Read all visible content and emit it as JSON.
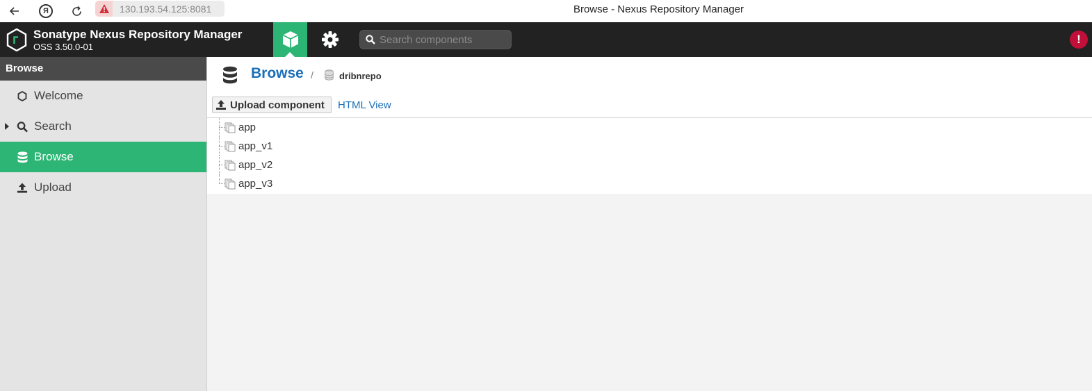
{
  "browser": {
    "url": "130.193.54.125:8081",
    "title": "Browse - Nexus Repository Manager",
    "ya_label": "Я"
  },
  "header": {
    "product_name": "Sonatype Nexus Repository Manager",
    "version": "OSS 3.50.0-01",
    "search_placeholder": "Search components",
    "alert_symbol": "!"
  },
  "sidebar": {
    "header": "Browse",
    "items": [
      {
        "label": "Welcome",
        "icon": "hexagon-icon",
        "active": false
      },
      {
        "label": "Search",
        "icon": "search-icon",
        "active": false
      },
      {
        "label": "Browse",
        "icon": "database-icon",
        "active": true
      },
      {
        "label": "Upload",
        "icon": "upload-icon",
        "active": false
      }
    ]
  },
  "main": {
    "breadcrumb_title": "Browse",
    "breadcrumb_separator": "/",
    "repo_name": "dribnrepo",
    "upload_button": "Upload component",
    "html_view_link": "HTML View",
    "tree": [
      "app",
      "app_v1",
      "app_v2",
      "app_v3"
    ]
  },
  "colors": {
    "accent": "#2cb574",
    "header_bg": "#222222",
    "link": "#1b6fb8",
    "alert": "#c0103a"
  }
}
